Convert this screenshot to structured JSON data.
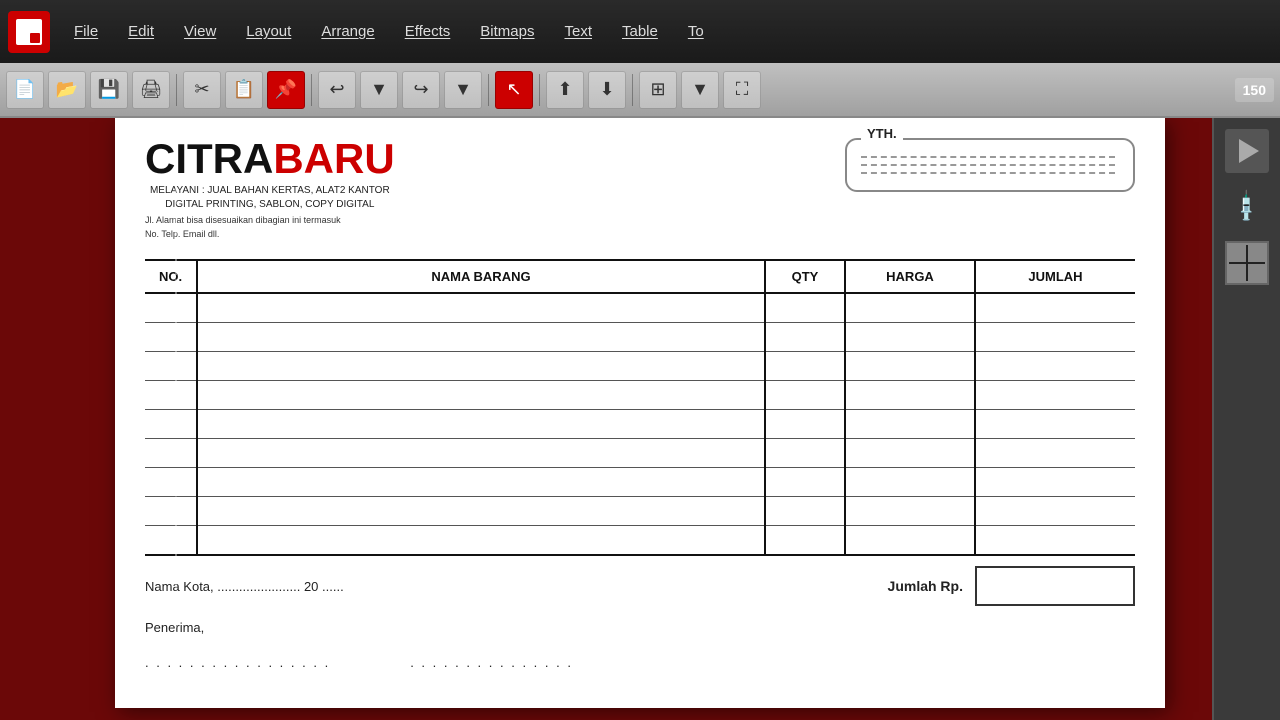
{
  "menubar": {
    "app_icon": "inkscape-icon",
    "items": [
      {
        "label": "File",
        "id": "menu-file"
      },
      {
        "label": "Edit",
        "id": "menu-edit"
      },
      {
        "label": "View",
        "id": "menu-view"
      },
      {
        "label": "Layout",
        "id": "menu-layout"
      },
      {
        "label": "Arrange",
        "id": "menu-arrange"
      },
      {
        "label": "Effects",
        "id": "menu-effects"
      },
      {
        "label": "Bitmaps",
        "id": "menu-bitmaps"
      },
      {
        "label": "Text",
        "id": "menu-text"
      },
      {
        "label": "Table",
        "id": "menu-table"
      },
      {
        "label": "To",
        "id": "menu-to"
      }
    ]
  },
  "toolbar": {
    "zoom_value": "150"
  },
  "invoice": {
    "logo_citra": "CITRA",
    "logo_baru": "BARU",
    "tagline_line1": "MELAYANI : JUAL BAHAN KERTAS, ALAT2 KANTOR",
    "tagline_line2": "DIGITAL PRINTING, SABLON, COPY DIGITAL",
    "address_line1": "Jl. Alamat bisa disesuaikan dibagian ini termasuk",
    "address_line2": "No. Telp. Email dll.",
    "yth_label": "YTH.",
    "recipient_dashes": [
      ".................................",
      ".................................",
      "................................."
    ],
    "table": {
      "headers": [
        "NO.",
        "NAMA BARANG",
        "QTY",
        "HARGA",
        "JUMLAH"
      ],
      "rows": 9
    },
    "footer": {
      "city_line": "Nama Kota,  .......................  20 ......",
      "jumlah_label": "Jumlah Rp.",
      "penerima": "Penerima,",
      "sig_line1": ". . . . . . . . . . . . . . . . .",
      "sig_line2": ". . . . . . . . . . . . . . ."
    }
  }
}
